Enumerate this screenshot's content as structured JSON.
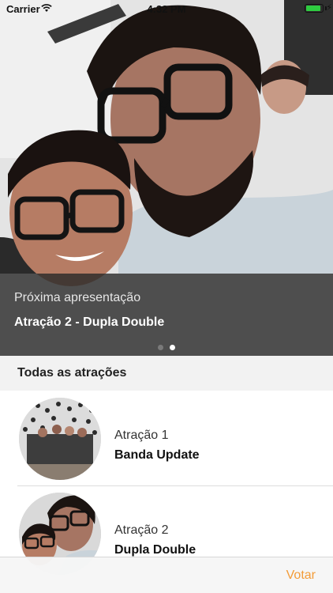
{
  "status_bar": {
    "carrier": "Carrier",
    "time": "4:32 PM",
    "battery_level": 0.9,
    "battery_color": "#2ECC40"
  },
  "hero": {
    "label": "Próxima apresentação",
    "title": "Atração 2 - Dupla Double",
    "page_count": 2,
    "current_page": 2
  },
  "section": {
    "title": "Todas as atrações"
  },
  "attractions": [
    {
      "subtitle": "Atração 1",
      "title": "Banda Update",
      "avatar": "band-group-photo"
    },
    {
      "subtitle": "Atração 2",
      "title": "Dupla Double",
      "avatar": "duo-selfie-photo"
    }
  ],
  "bottom_bar": {
    "vote_label": "Votar",
    "accent_color": "#F39C38"
  }
}
